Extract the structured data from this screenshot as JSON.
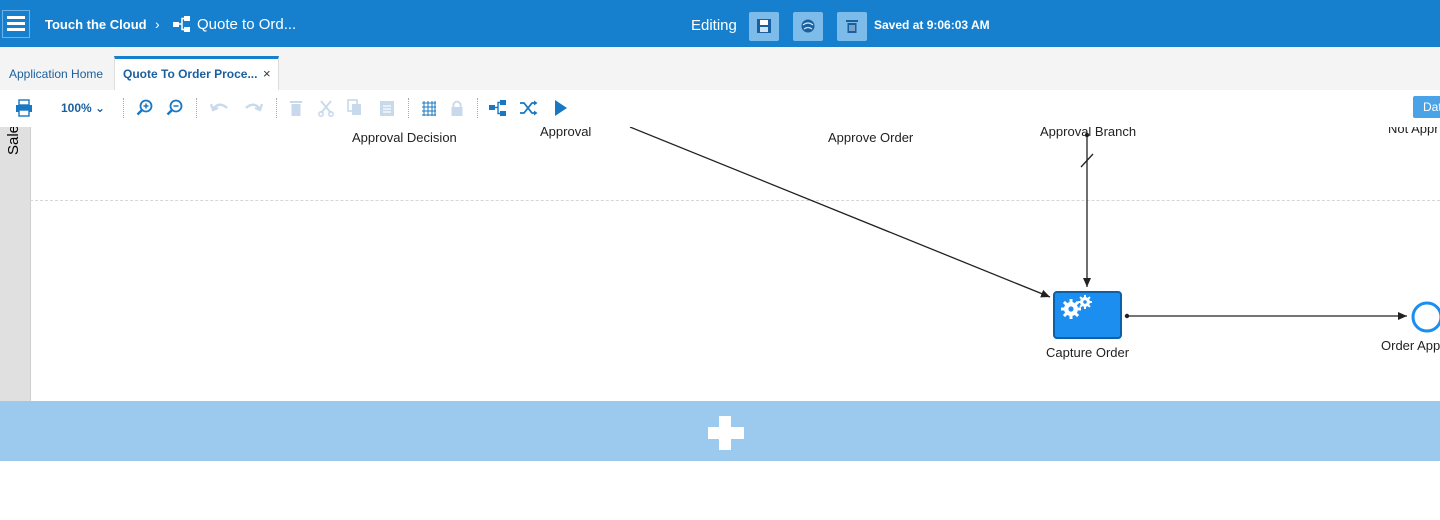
{
  "header": {
    "app_name": "Touch the Cloud",
    "separator": "›",
    "process_name": "Quote to Ord...",
    "mode": "Editing",
    "save_status": "Saved at 9:06:03 AM",
    "icons": [
      "menu-icon",
      "process-icon",
      "save-icon",
      "publish-icon",
      "delete-icon"
    ]
  },
  "tabs": [
    {
      "label": "Application Home",
      "active": false
    },
    {
      "label": "Quote To Order Proce...",
      "active": true,
      "close": "×"
    }
  ],
  "toolbar": {
    "zoom": "100%",
    "right_button": "Dat"
  },
  "canvas": {
    "lane_name": "Sale",
    "labels": {
      "approval_decision": "Approval Decision",
      "approval": "Approval",
      "approve_order": "Approve Order",
      "approval_branch": "Approval Branch",
      "not_approved": "Not Appr",
      "capture_order": "Capture Order",
      "order_approved": "Order App"
    }
  },
  "colors": {
    "header_bg": "#1680cf",
    "task_fill": "#1c8ef0",
    "add_lane_bg": "#9ccaee"
  }
}
